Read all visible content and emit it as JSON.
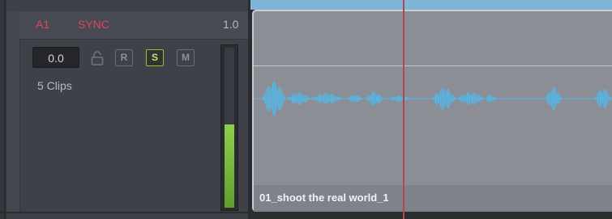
{
  "track": {
    "name": "A1",
    "sync_label": "SYNC",
    "volume_label": "1.0",
    "volume_value": "0.0",
    "clips_count": "5 Clips",
    "buttons": {
      "record": "R",
      "solo": "S",
      "mute": "M"
    },
    "solo_active": true,
    "meter_level": 0.52,
    "colors": {
      "track_name": "#e2455a",
      "solo_accent": "#8cc63f",
      "meter": "#7ccf3e"
    }
  },
  "timeline": {
    "clip": {
      "name": "01_shoot the real world_1",
      "waveform_color": "#56b6e6"
    },
    "ruler_color": "#7fb6d8",
    "playhead_color": "#b3474d"
  },
  "icons": {
    "lock": "lock-icon"
  }
}
